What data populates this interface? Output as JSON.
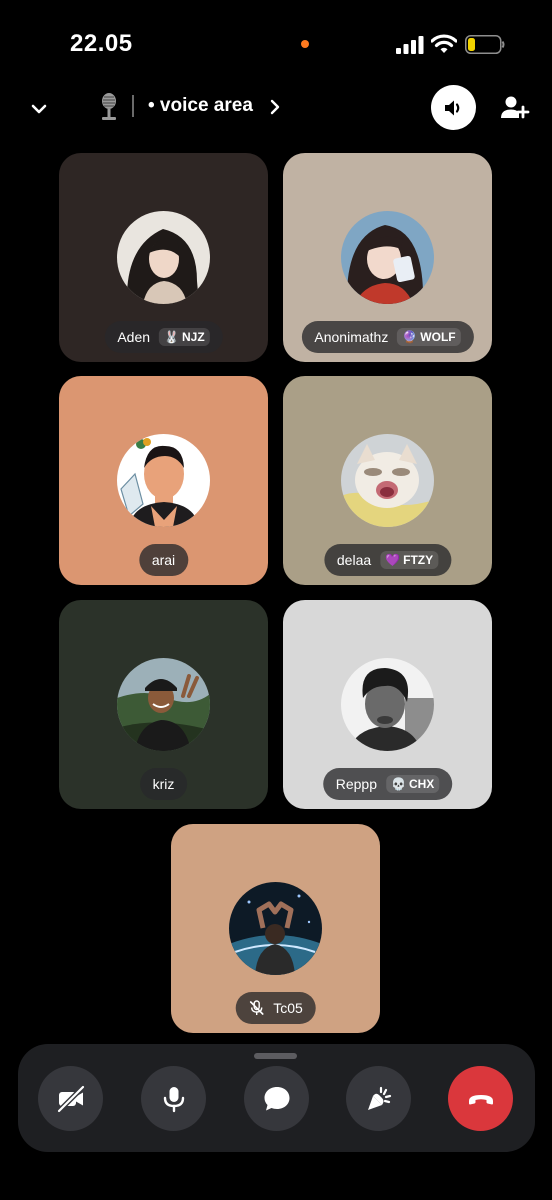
{
  "status_bar": {
    "time": "22.05",
    "recording_dot_color": "#ff7a1f",
    "battery_color": "#f2d300"
  },
  "header": {
    "channel_icon": "microphone-stand-icon",
    "channel_name": "• voice area",
    "collapse_icon": "chevron-down-icon",
    "open_icon": "chevron-right-icon",
    "speaker_icon": "speaker-icon",
    "invite_icon": "add-user-icon"
  },
  "participants": [
    {
      "name": "Aden",
      "tag_emoji": "🐰",
      "tag": "NJZ",
      "tile_color": "#2e2624"
    },
    {
      "name": "Anonimathz",
      "tag_emoji": "🔮",
      "tag": "WOLF",
      "tile_color": "#c0b2a3"
    },
    {
      "name": "arai",
      "tag_emoji": "",
      "tag": "",
      "tile_color": "#db9671"
    },
    {
      "name": "delaa",
      "tag_emoji": "💜",
      "tag": "FTZY",
      "tile_color": "#aa9f87"
    },
    {
      "name": "kriz",
      "tag_emoji": "",
      "tag": "",
      "tile_color": "#2b3229"
    },
    {
      "name": "Reppp",
      "tag_emoji": "💀",
      "tag": "CHX",
      "tile_color": "#d8d8d8"
    },
    {
      "name": "Tc05",
      "tag_emoji": "",
      "tag": "",
      "muted": true,
      "tile_color": "#cfa282"
    }
  ],
  "controls": {
    "camera_icon": "camera-off-icon",
    "mic_icon": "microphone-icon",
    "chat_icon": "chat-bubble-icon",
    "activity_icon": "rocket-icon",
    "hangup_icon": "hang-up-icon",
    "hangup_color": "#da373c"
  }
}
